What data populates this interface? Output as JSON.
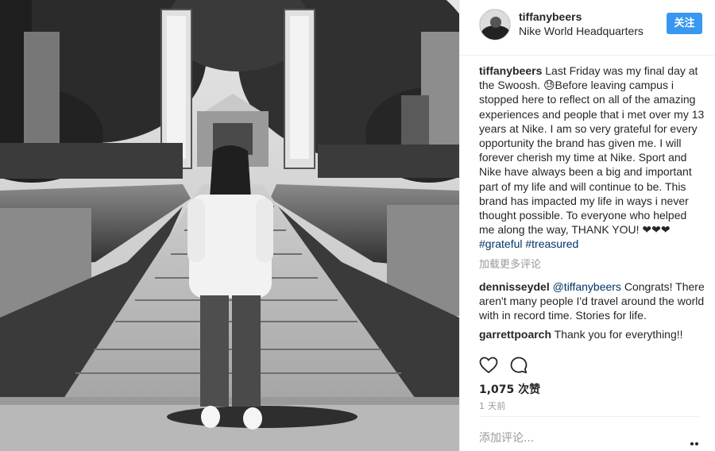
{
  "post": {
    "username": "tiffanybeers",
    "location": "Nike World Headquarters",
    "follow_label": "关注",
    "caption": {
      "author": "tiffanybeers",
      "text": " Last Friday was my final day at the Swoosh. 😓Before leaving campus i stopped here to reflect on all of the amazing experiences and people that i met over my 13 years at Nike. I am so very grateful for every opportunity the brand has given me. I will forever cherish my time at Nike. Sport and Nike have always been a big and important part of my life and will continue to be. This brand has impacted my life in ways i never thought possible. To everyone who helped me along the way, THANK YOU! ❤❤❤",
      "hashtag1": "#grateful",
      "hashtag2": "#treasured"
    },
    "load_more": "加载更多评论",
    "comments": [
      {
        "author": "dennisseydel",
        "mention": "@tiffanybeers",
        "text": " Congrats! There aren't many people I'd travel around the world with in record time. Stories for life."
      },
      {
        "author": "garrettpoarch",
        "text": " Thank you for everything!!"
      }
    ],
    "likes": "1,075 次赞",
    "timestamp": "1 天前",
    "add_comment_placeholder": "添加评论..."
  },
  "icons": {
    "like": "heart-icon",
    "comment": "comment-icon",
    "more": "more-options-icon"
  },
  "colors": {
    "follow_button": "#3897f0",
    "link": "#003569",
    "muted": "#999999",
    "text": "#262626"
  }
}
